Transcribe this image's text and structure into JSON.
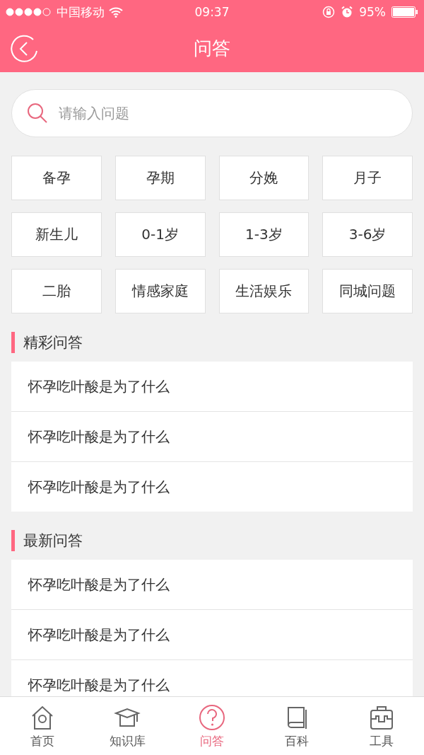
{
  "status_bar": {
    "carrier": "中国移动",
    "time": "09:37",
    "battery": "95%"
  },
  "header": {
    "title": "问答"
  },
  "search": {
    "placeholder": "请输入问题"
  },
  "categories": [
    "备孕",
    "孕期",
    "分娩",
    "月子",
    "新生儿",
    "0-1岁",
    "1-3岁",
    "3-6岁",
    "二胎",
    "情感家庭",
    "生活娱乐",
    "同城问题"
  ],
  "sections": [
    {
      "title": "精彩问答",
      "questions": [
        "怀孕吃叶酸是为了什么",
        "怀孕吃叶酸是为了什么",
        "怀孕吃叶酸是为了什么"
      ]
    },
    {
      "title": "最新问答",
      "questions": [
        "怀孕吃叶酸是为了什么",
        "怀孕吃叶酸是为了什么",
        "怀孕吃叶酸是为了什么"
      ]
    }
  ],
  "tab_bar": [
    {
      "label": "首页",
      "selected": false
    },
    {
      "label": "知识库",
      "selected": false
    },
    {
      "label": "问答",
      "selected": true
    },
    {
      "label": "百科",
      "selected": false
    },
    {
      "label": "工具",
      "selected": false
    }
  ]
}
